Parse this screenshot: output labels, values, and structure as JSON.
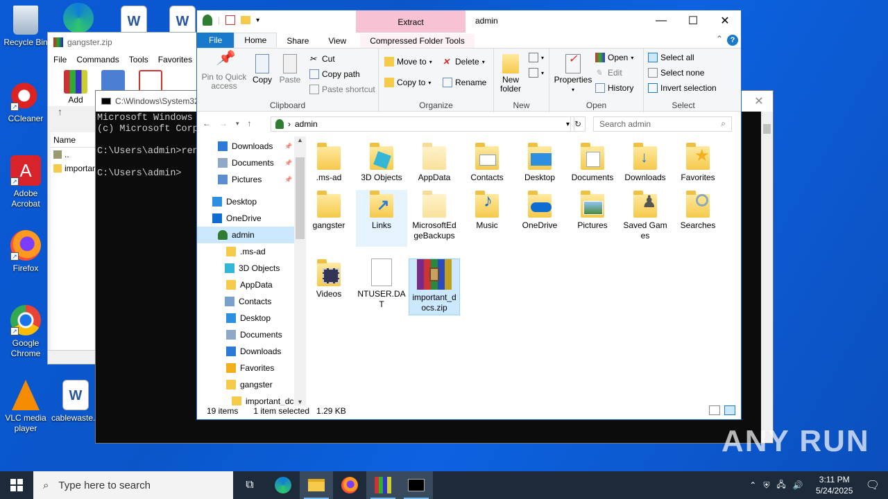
{
  "desktop": {
    "icons": [
      {
        "label": "Recycle Bin",
        "icon": "recycle-bin-icon"
      },
      {
        "label": "CCleaner",
        "icon": "ccleaner-icon"
      },
      {
        "label": "Adobe Acrobat",
        "icon": "acrobat-icon"
      },
      {
        "label": "Firefox",
        "icon": "firefox-icon"
      },
      {
        "label": "Google Chrome",
        "icon": "chrome-icon"
      },
      {
        "label": "VLC media player",
        "icon": "vlc-icon"
      },
      {
        "label": "cablewaste...",
        "icon": "word-doc-icon"
      }
    ],
    "watermark": "ANY RUN"
  },
  "winrar": {
    "title": "gangster.zip",
    "menu": [
      "File",
      "Commands",
      "Tools",
      "Favorites"
    ],
    "tool_add": "Add",
    "col_name": "Name",
    "rows": [
      "..",
      "importan"
    ]
  },
  "cmd": {
    "title": "C:\\Windows\\System32",
    "lines": [
      "Microsoft Windows",
      "(c) Microsoft Corp",
      "",
      "C:\\Users\\admin>ren",
      "",
      "C:\\Users\\admin>"
    ]
  },
  "explorer": {
    "window_title": "admin",
    "context_tab": "Extract",
    "context_tool": "Compressed Folder Tools",
    "tabs": [
      "File",
      "Home",
      "Share",
      "View"
    ],
    "ribbon": {
      "pin": "Pin to Quick access",
      "copy": "Copy",
      "paste": "Paste",
      "cut": "Cut",
      "copy_path": "Copy path",
      "paste_shortcut": "Paste shortcut",
      "clipboard": "Clipboard",
      "move_to": "Move to",
      "copy_to": "Copy to",
      "delete": "Delete",
      "rename": "Rename",
      "organize": "Organize",
      "new_folder": "New folder",
      "new": "New",
      "properties": "Properties",
      "open": "Open",
      "edit": "Edit",
      "history": "History",
      "open_grp": "Open",
      "select_all": "Select all",
      "select_none": "Select none",
      "invert": "Invert selection",
      "select": "Select"
    },
    "address": "admin",
    "search_placeholder": "Search admin",
    "nav": [
      {
        "label": "Downloads",
        "pin": true
      },
      {
        "label": "Documents",
        "pin": true
      },
      {
        "label": "Pictures",
        "pin": true
      },
      {
        "label": "Desktop"
      },
      {
        "label": "OneDrive"
      },
      {
        "label": "admin",
        "selected": true
      },
      {
        "label": ".ms-ad"
      },
      {
        "label": "3D Objects"
      },
      {
        "label": "AppData"
      },
      {
        "label": "Contacts"
      },
      {
        "label": "Desktop"
      },
      {
        "label": "Documents"
      },
      {
        "label": "Downloads"
      },
      {
        "label": "Favorites"
      },
      {
        "label": "gangster"
      },
      {
        "label": "important_dc"
      }
    ],
    "files": [
      {
        "name": ".ms-ad"
      },
      {
        "name": "3D Objects"
      },
      {
        "name": "AppData"
      },
      {
        "name": "Contacts"
      },
      {
        "name": "Desktop"
      },
      {
        "name": "Documents"
      },
      {
        "name": "Downloads"
      },
      {
        "name": "Favorites"
      },
      {
        "name": "gangster"
      },
      {
        "name": "Links"
      },
      {
        "name": "MicrosoftEdgeBackups"
      },
      {
        "name": "Music"
      },
      {
        "name": "OneDrive"
      },
      {
        "name": "Pictures"
      },
      {
        "name": "Saved Games"
      },
      {
        "name": "Searches"
      },
      {
        "name": "Videos"
      },
      {
        "name": "NTUSER.DAT"
      },
      {
        "name": "important_docs.zip"
      }
    ],
    "status_count": "19 items",
    "status_sel": "1 item selected",
    "status_size": "1.29 KB"
  },
  "taskbar": {
    "search_placeholder": "Type here to search",
    "time": "3:11 PM",
    "date": "5/24/2025"
  }
}
